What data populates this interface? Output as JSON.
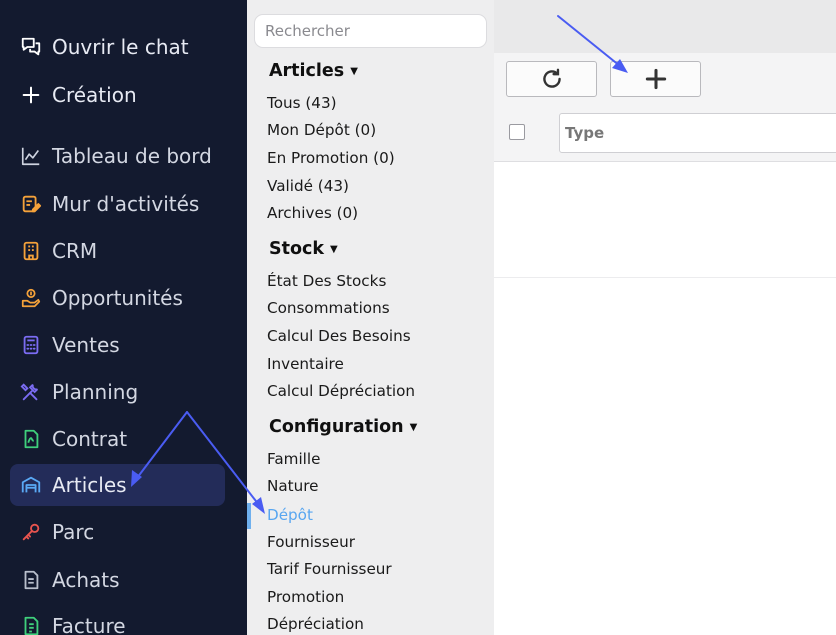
{
  "sidebar": {
    "items": [
      {
        "label": "Ouvrir le chat",
        "icon": "chat-bubbles-icon"
      },
      {
        "label": "Création",
        "icon": "plus-icon"
      },
      {
        "label": "Tableau de bord",
        "icon": "line-chart-icon"
      },
      {
        "label": "Mur d'activités",
        "icon": "note-pencil-icon"
      },
      {
        "label": "CRM",
        "icon": "building-icon"
      },
      {
        "label": "Opportunités",
        "icon": "hand-coin-icon"
      },
      {
        "label": "Ventes",
        "icon": "calculator-icon"
      },
      {
        "label": "Planning",
        "icon": "tools-icon"
      },
      {
        "label": "Contrat",
        "icon": "contract-document-icon"
      },
      {
        "label": "Articles",
        "icon": "warehouse-icon",
        "active": true
      },
      {
        "label": "Parc",
        "icon": "key-icon"
      },
      {
        "label": "Achats",
        "icon": "receipt-icon"
      },
      {
        "label": "Facture",
        "icon": "invoice-icon"
      }
    ],
    "colors": {
      "background": "#131a2f",
      "active": "#232c59",
      "text": "#e7eaf3"
    }
  },
  "menu": {
    "search_placeholder": "Rechercher",
    "sections": [
      {
        "title": "Articles",
        "links": [
          "Tous (43)",
          "Mon Dépôt (0)",
          "En Promotion (0)",
          "Validé (43)",
          "Archives (0)"
        ]
      },
      {
        "title": "Stock",
        "links": [
          "État Des Stocks",
          "Consommations",
          "Calcul Des Besoins",
          "Inventaire",
          "Calcul Dépréciation"
        ]
      },
      {
        "title": "Configuration",
        "links": [
          "Famille",
          "Nature",
          "Dépôt",
          "Fournisseur",
          "Tarif Fournisseur",
          "Promotion",
          "Dépréciation"
        ]
      }
    ],
    "selected": "Dépôt",
    "colors": {
      "background": "#eeeeef",
      "selected": "#58a6f0"
    }
  },
  "content": {
    "toolbar": {
      "refresh_icon": "refresh-icon",
      "add_icon": "plus-icon"
    },
    "table": {
      "filter_placeholder": "Type"
    }
  },
  "annotations": {
    "arrow_color": "#4a5cf2"
  }
}
